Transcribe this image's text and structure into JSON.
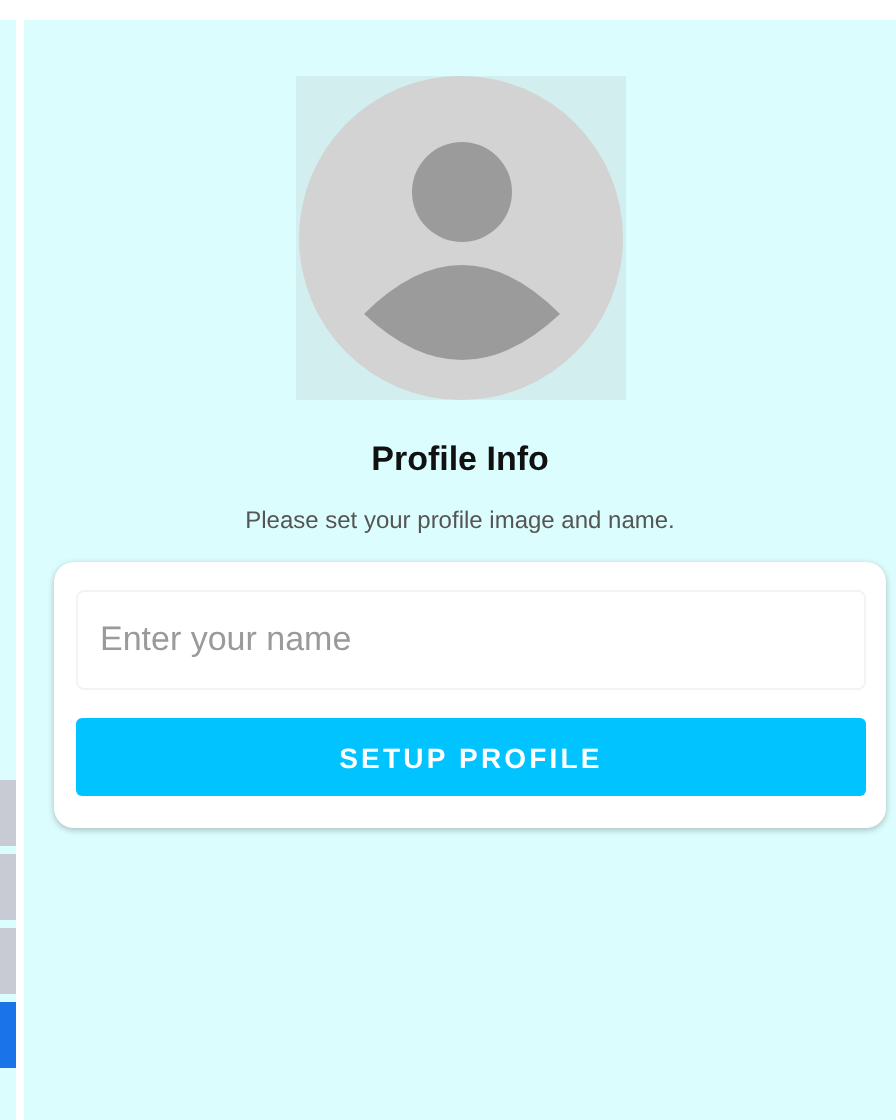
{
  "side_tabs": [
    {
      "selected": false
    },
    {
      "selected": false
    },
    {
      "selected": false
    },
    {
      "selected": true
    }
  ],
  "profile": {
    "title": "Profile Info",
    "subtitle": "Please set your profile image and name."
  },
  "name_field": {
    "placeholder": "Enter your name"
  },
  "buttons": [
    "SETUP PROFILE"
  ]
}
